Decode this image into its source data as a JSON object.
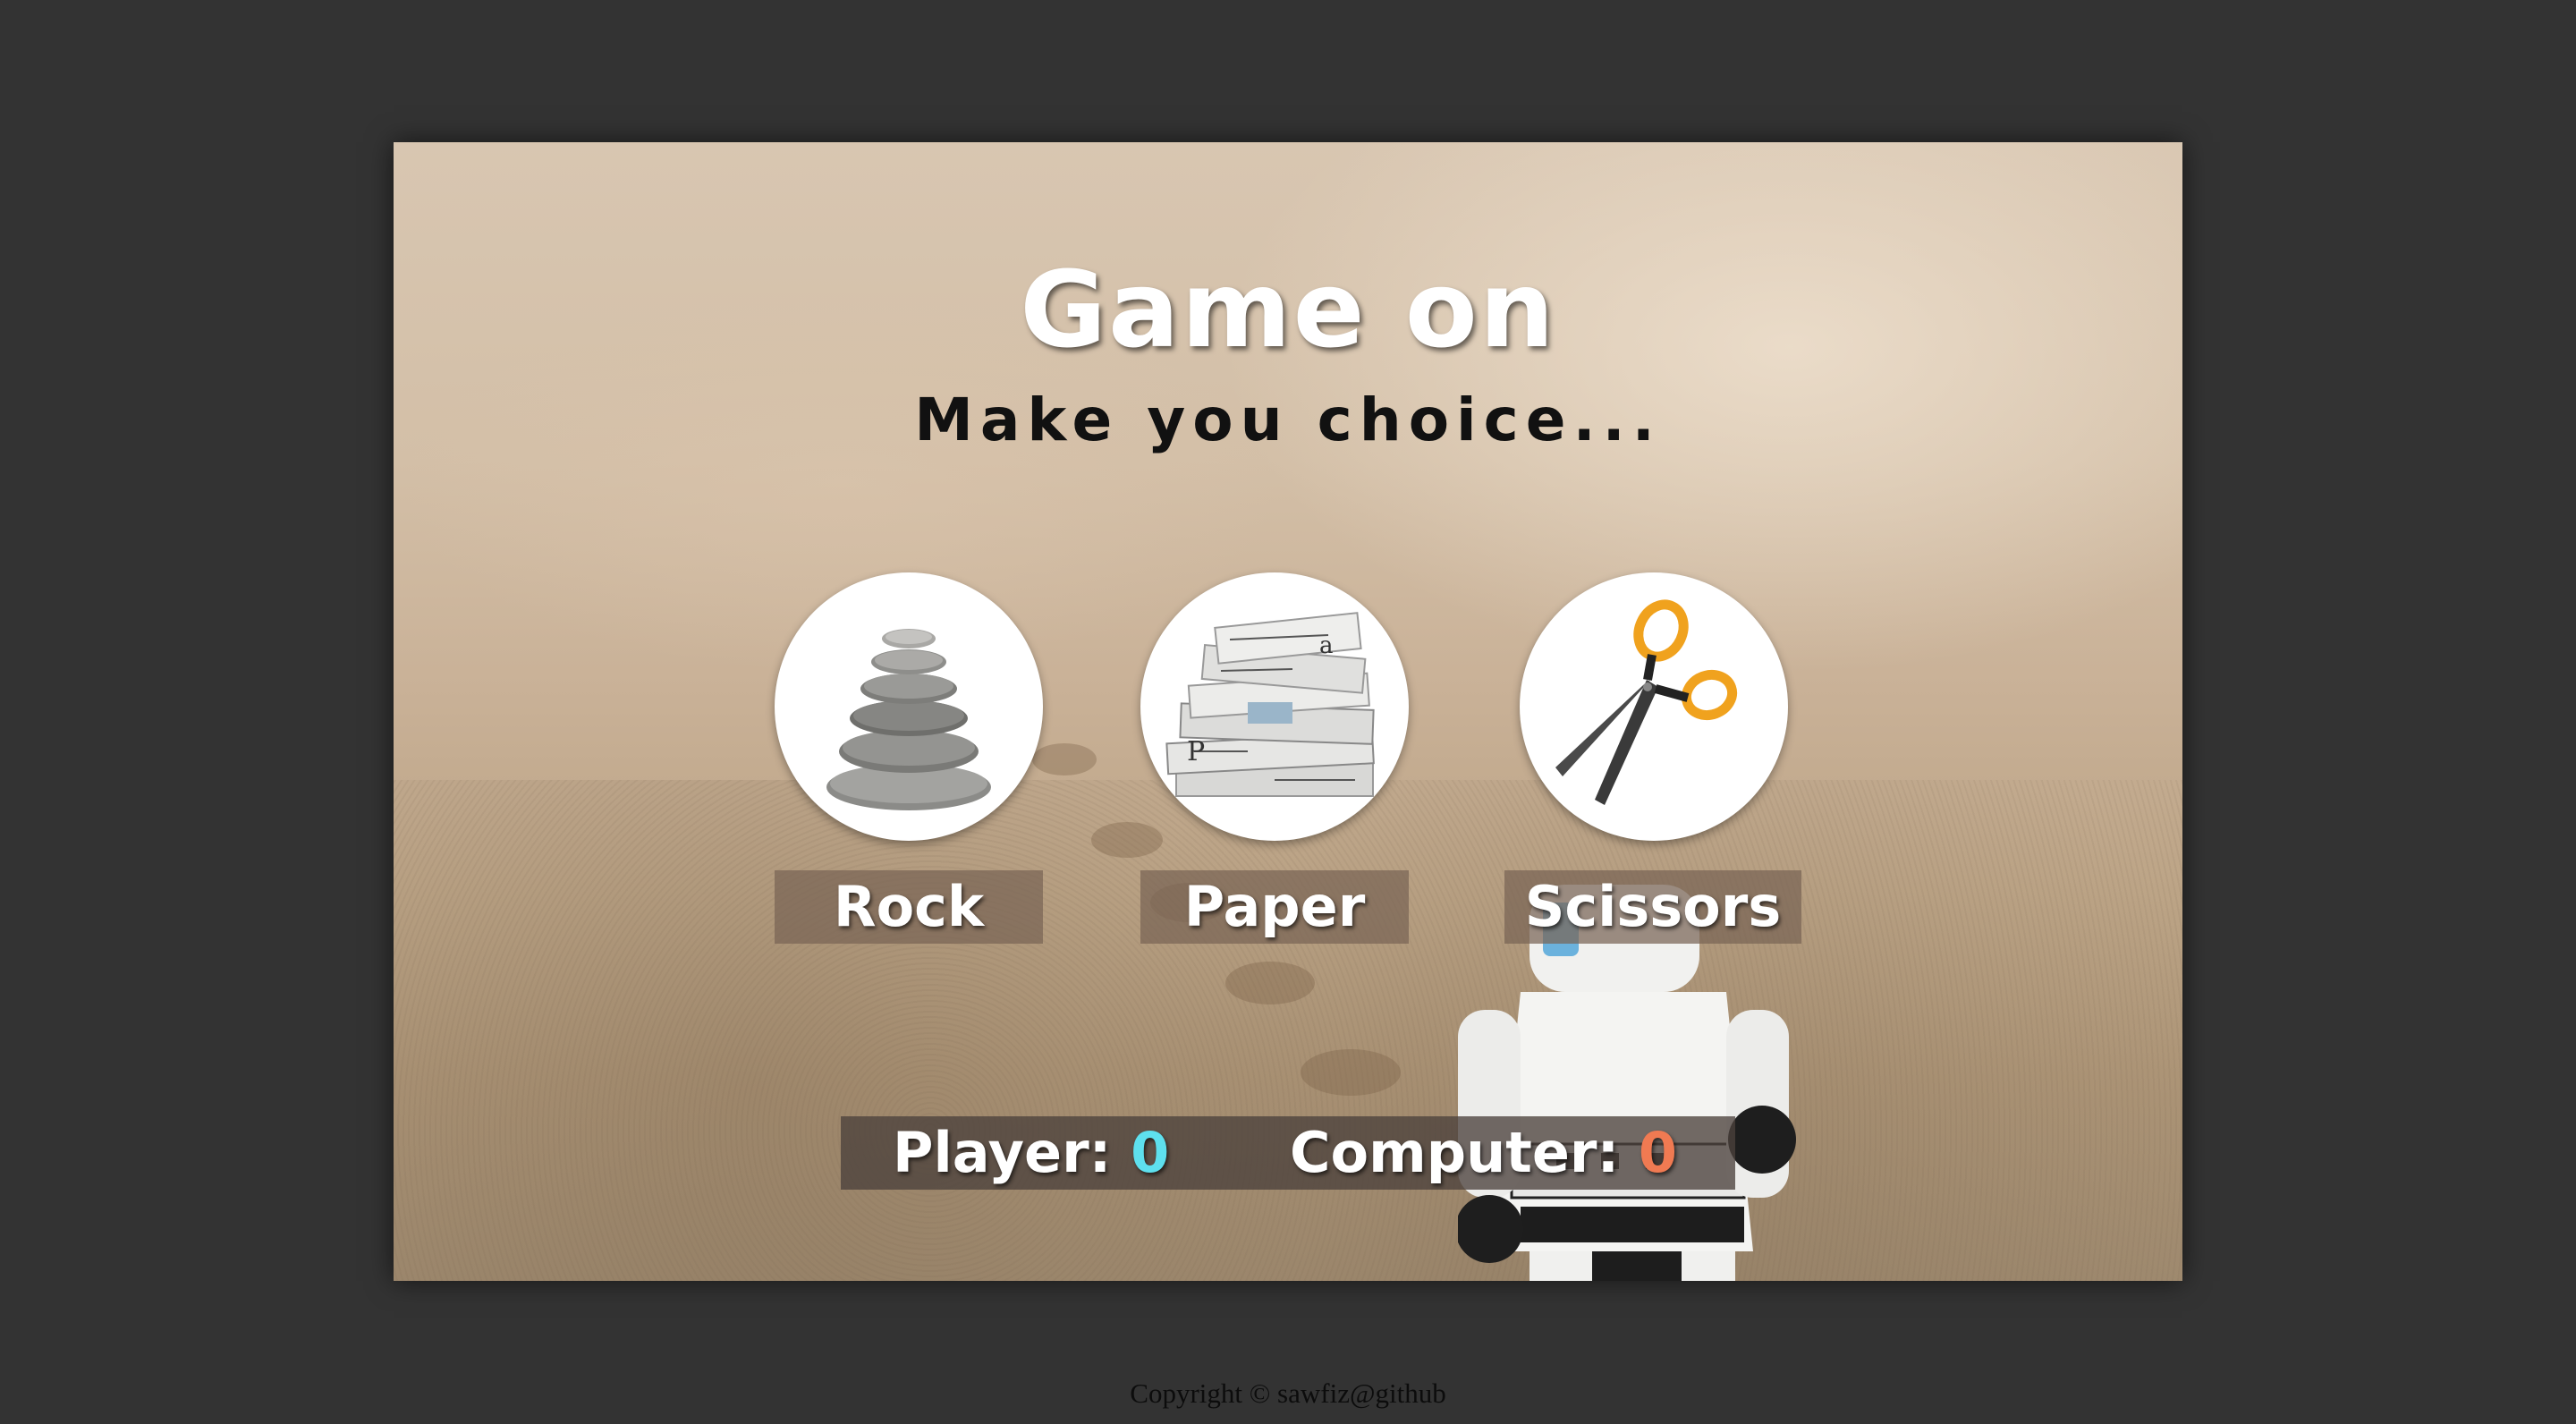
{
  "game": {
    "title": "Game on",
    "subtitle": "Make you choice..."
  },
  "choices": [
    {
      "id": "rock",
      "label": "Rock",
      "icon": "rock-stack-icon"
    },
    {
      "id": "paper",
      "label": "Paper",
      "icon": "newspaper-stack-icon"
    },
    {
      "id": "scissors",
      "label": "Scissors",
      "icon": "scissors-icon"
    }
  ],
  "scoreboard": {
    "player_label": "Player:",
    "player_score": "0",
    "computer_label": "Computer:",
    "computer_score": "0",
    "player_color": "#5ee0ee",
    "computer_color": "#f07a52"
  },
  "footer": {
    "copyright": "Copyright © sawfiz@github"
  },
  "colors": {
    "page_background": "#333333",
    "title_text": "#ffffff"
  }
}
